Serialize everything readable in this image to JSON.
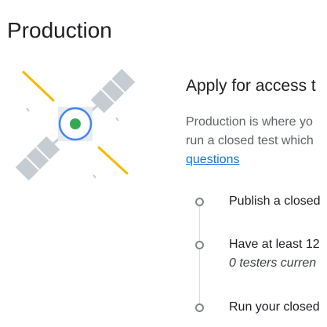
{
  "header": {
    "title": "Production"
  },
  "illustration": {
    "icon": "satellite-icon",
    "colors": {
      "panel": "#c5cdd3",
      "ray": "#f6b800",
      "ring": "#4285f4",
      "core": "#34a853"
    }
  },
  "apply": {
    "heading": "Apply for access t",
    "description_line1": "Production is where yo",
    "description_line2": "run a closed test which",
    "link_label": "questions"
  },
  "steps": [
    {
      "label": "Publish a closed",
      "sub": ""
    },
    {
      "label": "Have at least 12",
      "sub": "0 testers curren"
    },
    {
      "label": "Run your closed",
      "sub": ""
    }
  ]
}
